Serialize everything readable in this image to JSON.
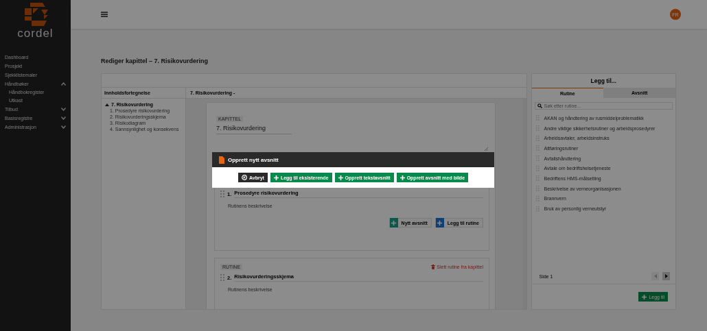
{
  "sidebar": {
    "logo_text": "cordel",
    "items": [
      {
        "label": "Dashboard"
      },
      {
        "label": "Prosjekt"
      },
      {
        "label": "Sjekklistemaler"
      },
      {
        "label": "Håndbøker",
        "expanded": true,
        "children": [
          {
            "label": "Håndbokregister"
          },
          {
            "label": "Utkast"
          }
        ]
      },
      {
        "label": "Tilbud",
        "expanded": false
      },
      {
        "label": "Basisregistre",
        "expanded": false
      },
      {
        "label": "Administrasjon",
        "expanded": false
      }
    ]
  },
  "topbar": {
    "avatar": "FR"
  },
  "page_title": "Rediger kapittel – 7. Risikovurdering",
  "editor": {
    "toc_header": "Innholdsfortegnelse",
    "content_header": "7. Risikovurdering -",
    "toc": [
      {
        "label": "7. Risikovurdering",
        "expanded": true,
        "children": [
          {
            "label": "1. Prosedyre risikovurdering"
          },
          {
            "label": "2. Risikovurderingsskjema"
          },
          {
            "label": "3. Risikodiagram"
          },
          {
            "label": "4. Sannsynlighet og konsekvens"
          }
        ]
      }
    ],
    "chapter": {
      "tag": "KAPITTEL",
      "title": "7. Risikovurdering"
    },
    "sections": [
      {
        "number": "1.",
        "title": "Prosedyre risikovurdering",
        "description": "Rutinens beskrivelse",
        "buttons": [
          {
            "label": "Nytt avsnitt",
            "kind": "section"
          },
          {
            "label": "Legg til rutine",
            "kind": "routine"
          }
        ]
      },
      {
        "tag": "RUTINE",
        "delete_label": "Slett rutine fra kapittel",
        "number": "2.",
        "title": "Risikovurderingsskjema",
        "description": "Rutinens beskrivelse"
      }
    ]
  },
  "add_panel": {
    "title": "Legg til...",
    "tabs": [
      {
        "label": "Rutine",
        "selected": true
      },
      {
        "label": "Avsnitt",
        "selected": false
      }
    ],
    "search": {
      "placeholder": "Søk etter rutine..."
    },
    "items": [
      "AKAN og håndtering av rusmiddelproblematikk",
      "Andre viktige sikkerhetsrutiner og arbeidsprosedyrer",
      "Arbeidsavtaler, arbeidsinstruks",
      "Attføringsrutiner",
      "Avfallshåndtering",
      "Avtale om bedriftshelsetjeneste",
      "Bedriftens HMS-målsetting",
      "Beskrivelse av verneorganisasjonen",
      "Brannvern",
      "Bruk av personlig verneutstyr"
    ],
    "pager": {
      "label": "Side 1",
      "prev_disabled": true,
      "next_disabled": false
    },
    "add_button": "Legg til"
  },
  "modal": {
    "title": "Opprett nytt avsnitt",
    "buttons": [
      {
        "label": "Avbryt",
        "kind": "cancel"
      },
      {
        "label": "Legg til eksisterende",
        "kind": "add"
      },
      {
        "label": "Opprett tekstavsnitt",
        "kind": "add"
      },
      {
        "label": "Opprett avsnitt med bilde",
        "kind": "add"
      }
    ]
  }
}
